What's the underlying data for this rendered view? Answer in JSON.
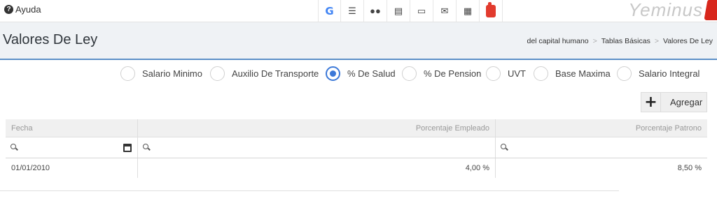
{
  "topbar": {
    "help_label": "Ayuda",
    "toolbar_icons": [
      "google-icon",
      "server-icon",
      "users-icon",
      "id-card-icon",
      "laptop-icon",
      "mail-icon",
      "calendar-icon",
      "thumbs-up-icon"
    ],
    "brand": "Yeminus"
  },
  "header": {
    "title": "Valores De Ley",
    "breadcrumb": [
      "del capital humano",
      "Tablas Básicas",
      "Valores De Ley"
    ]
  },
  "radios": {
    "options": [
      "Salario Minimo",
      "Auxilio De Transporte",
      "% De Salud",
      "% De Pension",
      "UVT",
      "Base Maxima",
      "Salario Integral"
    ],
    "selected": "% De Salud"
  },
  "actions": {
    "add_label": "Agregar"
  },
  "grid": {
    "columns": [
      "Fecha",
      "Porcentaje Empleado",
      "Porcentaje Patrono"
    ],
    "rows": [
      {
        "fecha": "01/01/2010",
        "empleado": "4,00 %",
        "patrono": "8,50 %"
      }
    ]
  },
  "colors": {
    "accent": "#3b78d8",
    "header_bg": "#eff2f5",
    "header_border": "#5b8fc7",
    "brand_red": "#d8271c"
  }
}
